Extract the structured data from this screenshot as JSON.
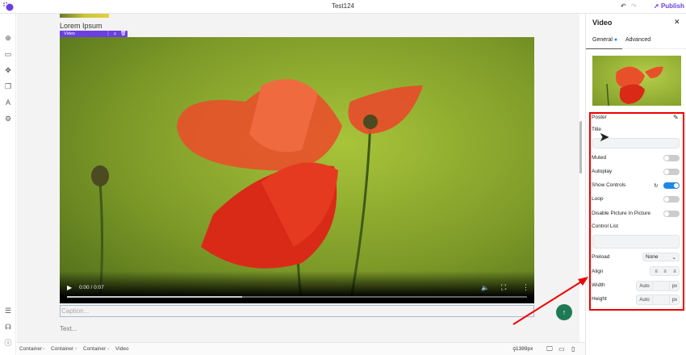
{
  "app": {
    "title": "Test124",
    "publish_label": "Publish"
  },
  "canvas": {
    "heading": "Lorem Ipsum",
    "element_tag": "Video",
    "caption_placeholder": "Caption...",
    "text_placeholder": "Text...",
    "video": {
      "time": "0:00 / 0:07",
      "progress": 0.38
    }
  },
  "breadcrumb": [
    "Container",
    "Container",
    "Container",
    "Video"
  ],
  "viewport": {
    "width_label": "1389px"
  },
  "panel": {
    "title": "Video",
    "tabs": [
      {
        "label": "General",
        "active": true
      },
      {
        "label": "Advanced",
        "active": false
      }
    ],
    "poster_label": "Poster",
    "title_label": "Title",
    "title_value": "",
    "toggles": [
      {
        "label": "Muted",
        "on": false
      },
      {
        "label": "Autoplay",
        "on": false
      },
      {
        "label": "Show Controls",
        "on": true
      },
      {
        "label": "Loop",
        "on": false
      },
      {
        "label": "Disable Picture In Picture",
        "on": false
      }
    ],
    "control_list_label": "Control List",
    "control_list_value": "",
    "preload_label": "Preload",
    "preload_value": "None",
    "align_label": "Align",
    "width_label": "Width",
    "width_value": "Auto",
    "width_unit": "px",
    "height_label": "Height",
    "height_value": "Auto",
    "height_unit": "px"
  },
  "colors": {
    "accent": "#6b3fe0",
    "toggle_on": "#1e88e5",
    "highlight": "#e00000",
    "fab": "#1e7a52"
  }
}
